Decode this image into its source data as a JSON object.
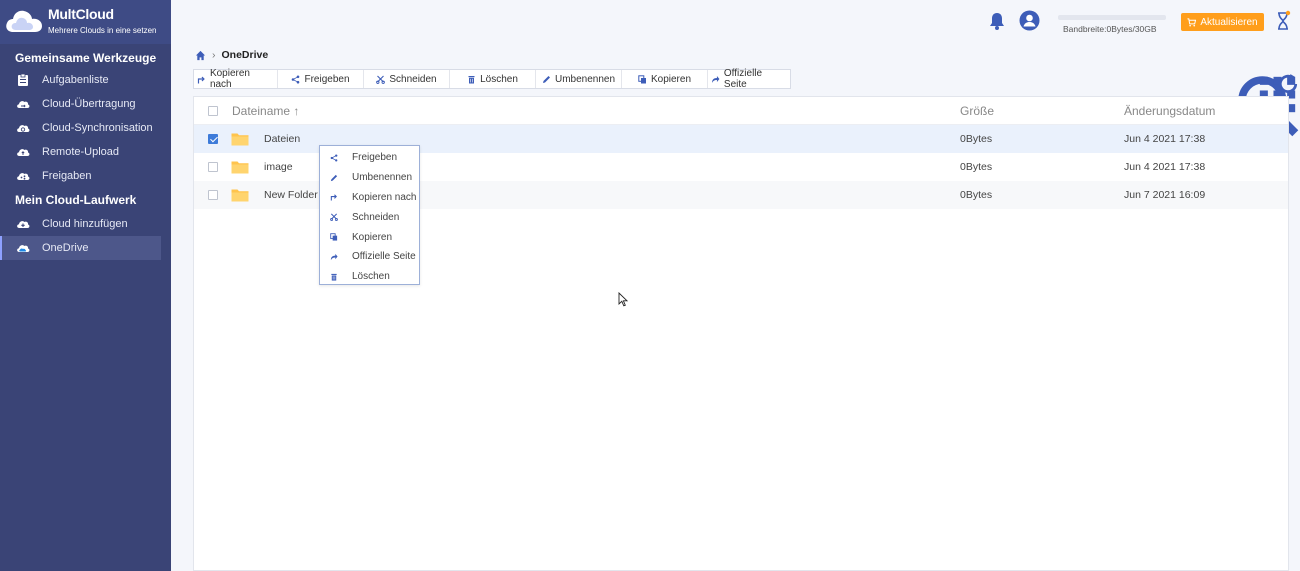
{
  "app": {
    "title": "MultCloud",
    "subtitle": "Mehrere Clouds in eine setzen"
  },
  "sidebar": {
    "section1": "Gemeinsame Werkzeuge",
    "section2": "Mein Cloud-Laufwerk",
    "tools": [
      {
        "label": "Aufgabenliste",
        "icon": "clipboard-icon"
      },
      {
        "label": "Cloud-Übertragung",
        "icon": "cloud-transfer-icon"
      },
      {
        "label": "Cloud-Synchronisation",
        "icon": "cloud-sync-icon"
      },
      {
        "label": "Remote-Upload",
        "icon": "cloud-upload-icon"
      },
      {
        "label": "Freigaben",
        "icon": "cloud-share-icon"
      }
    ],
    "drives": [
      {
        "label": "Cloud hinzufügen",
        "icon": "cloud-add-icon"
      },
      {
        "label": "OneDrive",
        "icon": "onedrive-icon",
        "active": true
      }
    ]
  },
  "header": {
    "bandwidth": "Bandbreite:0Bytes/30GB",
    "bandwidth_used_fraction": 0,
    "upgrade_label": "Aktualisieren",
    "accent": "#ff9e1b"
  },
  "breadcrumb": {
    "current": "OneDrive"
  },
  "toolbar": {
    "buttons": [
      {
        "label": "Kopieren nach",
        "icon": "copy-to-icon"
      },
      {
        "label": "Freigeben",
        "icon": "share-icon"
      },
      {
        "label": "Schneiden",
        "icon": "cut-icon"
      },
      {
        "label": "Löschen",
        "icon": "trash-icon"
      },
      {
        "label": "Umbenennen",
        "icon": "pencil-icon"
      },
      {
        "label": "Kopieren",
        "icon": "copy-icon"
      },
      {
        "label": "Offizielle Seite",
        "icon": "external-icon"
      }
    ]
  },
  "table": {
    "columns": {
      "name": "Dateiname",
      "size": "Größe",
      "date": "Änderungsdatum"
    },
    "sort_indicator": "↑",
    "rows": [
      {
        "name": "Dateien",
        "size": "0Bytes",
        "date": "Jun 4 2021 17:38",
        "selected": true
      },
      {
        "name": "image",
        "size": "0Bytes",
        "date": "Jun 4 2021 17:38",
        "selected": false
      },
      {
        "name": "New Folder",
        "size": "0Bytes",
        "date": "Jun 7 2021 16:09",
        "selected": false
      }
    ]
  },
  "context_menu": {
    "items": [
      {
        "label": "Freigeben",
        "icon": "share-icon"
      },
      {
        "label": "Umbenennen",
        "icon": "pencil-icon"
      },
      {
        "label": "Kopieren nach",
        "icon": "copy-to-icon"
      },
      {
        "label": "Schneiden",
        "icon": "cut-icon"
      },
      {
        "label": "Kopieren",
        "icon": "copy-icon"
      },
      {
        "label": "Offizielle Seite",
        "icon": "external-icon"
      },
      {
        "label": "Löschen",
        "icon": "trash-icon"
      }
    ]
  },
  "colors": {
    "sidebar": "#3a4476",
    "icon_blue": "#3d5db8",
    "folder": "#ffc44d"
  }
}
